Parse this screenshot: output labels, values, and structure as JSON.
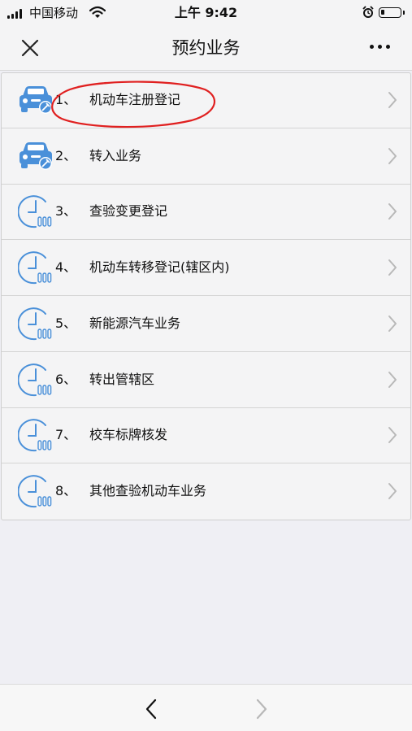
{
  "status_bar": {
    "carrier": "中国移动",
    "time": "上午 9:42"
  },
  "nav": {
    "title": "预约业务"
  },
  "colors": {
    "icon_blue": "#4a90d9",
    "annotation_red": "#e02020",
    "chevron_gray": "#b8b8b8"
  },
  "items": [
    {
      "num": "1、",
      "label": "机动车注册登记",
      "icon": "car-icon"
    },
    {
      "num": "2、",
      "label": "转入业务",
      "icon": "car-icon"
    },
    {
      "num": "3、",
      "label": "查验变更登记",
      "icon": "clock-icon"
    },
    {
      "num": "4、",
      "label": "机动车转移登记(辖区内)",
      "icon": "clock-icon"
    },
    {
      "num": "5、",
      "label": "新能源汽车业务",
      "icon": "clock-icon"
    },
    {
      "num": "6、",
      "label": "转出管辖区",
      "icon": "clock-icon"
    },
    {
      "num": "7、",
      "label": "校车标牌核发",
      "icon": "clock-icon"
    },
    {
      "num": "8、",
      "label": "其他查验机动车业务",
      "icon": "clock-icon"
    }
  ]
}
